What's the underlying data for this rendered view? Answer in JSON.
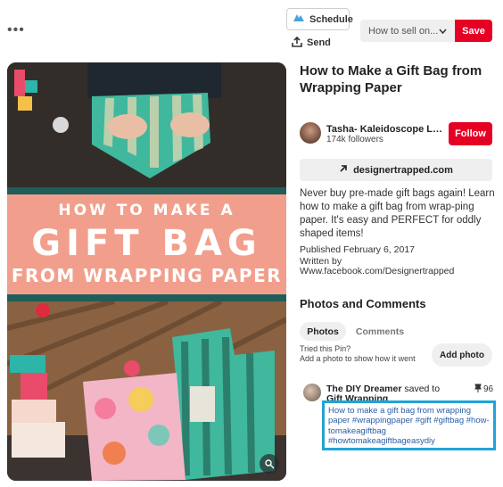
{
  "toolbar": {
    "more_label": "•••",
    "schedule_label": "Schedule",
    "send_label": "Send",
    "board_select_value": "How to sell on...",
    "save_label": "Save"
  },
  "pin_image": {
    "text_line1": "HOW TO MAKE A",
    "text_line2": "GIFT BAG",
    "text_line3": "FROM WRAPPING PAPER"
  },
  "details": {
    "title": "How to Make a Gift Bag from Wrapping Paper",
    "author_name": "Tasha- Kaleidoscope Livi...",
    "author_followers": "174k followers",
    "follow_label": "Follow",
    "link_label": "designertrapped.com",
    "description": "Never buy pre-made gift bags again! Learn how to make a gift bag from wrap-ping paper. It's easy and PERFECT for oddly shaped items!",
    "published": "Published February 6, 2017",
    "written_by": "Written by",
    "source": "Www.facebook.com/Designertrapped"
  },
  "photos_comments": {
    "title": "Photos and Comments",
    "tabs": [
      "Photos",
      "Comments"
    ],
    "tried_line1": "Tried this Pin?",
    "tried_line2": "Add a photo to show how it went",
    "add_photo_label": "Add photo"
  },
  "saved_by": {
    "name": "The DIY Dreamer",
    "action": "saved to",
    "board": "Gift Wrapping",
    "count": "96",
    "comment": "How to make a gift bag from wrapping paper #wrappingpaper #gift #giftbag #how-tomakeagiftbag #howtomakeagiftbageasydiy"
  },
  "colors": {
    "brand_red": "#e60023",
    "highlight_blue": "#21a3d8",
    "pin_pink": "#f19f8c",
    "pin_teal": "#1f5d5a"
  }
}
